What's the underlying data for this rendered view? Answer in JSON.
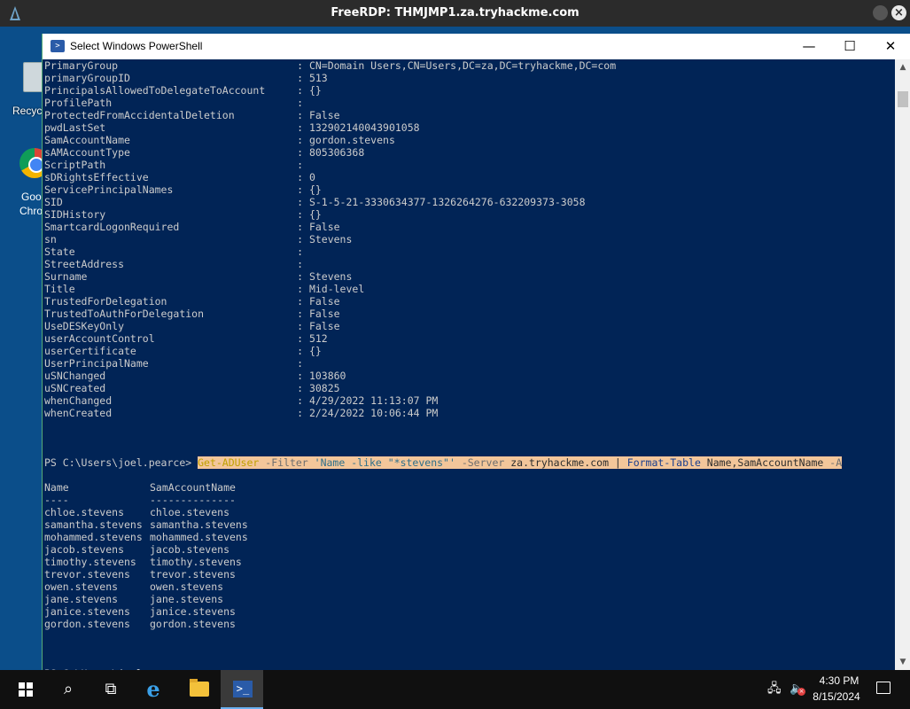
{
  "rdp": {
    "title": "FreeRDP: THMJMP1.za.tryhackme.com"
  },
  "desktop": {
    "icons": [
      {
        "label": "Recycl"
      },
      {
        "label_line1": "Goo",
        "label_line2": "Chro"
      }
    ]
  },
  "window": {
    "title": "Select Windows PowerShell",
    "minimize_glyph": "—",
    "maximize_glyph": "☐",
    "close_glyph": "✕"
  },
  "console": {
    "properties": [
      {
        "name": "PrimaryGroup",
        "value": "CN=Domain Users,CN=Users,DC=za,DC=tryhackme,DC=com"
      },
      {
        "name": "primaryGroupID",
        "value": "513"
      },
      {
        "name": "PrincipalsAllowedToDelegateToAccount",
        "value": "{}"
      },
      {
        "name": "ProfilePath",
        "value": ""
      },
      {
        "name": "ProtectedFromAccidentalDeletion",
        "value": "False"
      },
      {
        "name": "pwdLastSet",
        "value": "132902140043901058"
      },
      {
        "name": "SamAccountName",
        "value": "gordon.stevens"
      },
      {
        "name": "sAMAccountType",
        "value": "805306368"
      },
      {
        "name": "ScriptPath",
        "value": ""
      },
      {
        "name": "sDRightsEffective",
        "value": "0"
      },
      {
        "name": "ServicePrincipalNames",
        "value": "{}"
      },
      {
        "name": "SID",
        "value": "S-1-5-21-3330634377-1326264276-632209373-3058"
      },
      {
        "name": "SIDHistory",
        "value": "{}"
      },
      {
        "name": "SmartcardLogonRequired",
        "value": "False"
      },
      {
        "name": "sn",
        "value": "Stevens"
      },
      {
        "name": "State",
        "value": ""
      },
      {
        "name": "StreetAddress",
        "value": ""
      },
      {
        "name": "Surname",
        "value": "Stevens"
      },
      {
        "name": "Title",
        "value": "Mid-level"
      },
      {
        "name": "TrustedForDelegation",
        "value": "False"
      },
      {
        "name": "TrustedToAuthForDelegation",
        "value": "False"
      },
      {
        "name": "UseDESKeyOnly",
        "value": "False"
      },
      {
        "name": "userAccountControl",
        "value": "512"
      },
      {
        "name": "userCertificate",
        "value": "{}"
      },
      {
        "name": "UserPrincipalName",
        "value": ""
      },
      {
        "name": "uSNChanged",
        "value": "103860"
      },
      {
        "name": "uSNCreated",
        "value": "30825"
      },
      {
        "name": "whenChanged",
        "value": "4/29/2022 11:13:07 PM"
      },
      {
        "name": "whenCreated",
        "value": "2/24/2022 10:06:44 PM"
      }
    ],
    "prompt": "PS C:\\Users\\joel.pearce> ",
    "command": [
      {
        "text": "Get-ADUser",
        "style": "cmd-yellow"
      },
      {
        "text": " -Filter ",
        "style": "cmd-gray"
      },
      {
        "text": "'Name -like \"*stevens\"'",
        "style": "cmd-teal"
      },
      {
        "text": " -Server ",
        "style": "cmd-gray"
      },
      {
        "text": "za.tryhackme.com",
        "style": "cmd-dark"
      },
      {
        "text": " | ",
        "style": "cmd-dark"
      },
      {
        "text": "Format-Table",
        "style": "cmd-blue"
      },
      {
        "text": " Name,SamAccountName",
        "style": "cmd-dark"
      },
      {
        "text": " -A",
        "style": "cmd-gray"
      }
    ],
    "table": {
      "headers": [
        "Name",
        "SamAccountName"
      ],
      "underlines": [
        "----",
        "--------------"
      ],
      "rows": [
        [
          "chloe.stevens",
          "chloe.stevens"
        ],
        [
          "samantha.stevens",
          "samantha.stevens"
        ],
        [
          "mohammed.stevens",
          "mohammed.stevens"
        ],
        [
          "jacob.stevens",
          "jacob.stevens"
        ],
        [
          "timothy.stevens",
          "timothy.stevens"
        ],
        [
          "trevor.stevens",
          "trevor.stevens"
        ],
        [
          "owen.stevens",
          "owen.stevens"
        ],
        [
          "jane.stevens",
          "jane.stevens"
        ],
        [
          "janice.stevens",
          "janice.stevens"
        ],
        [
          "gordon.stevens",
          "gordon.stevens"
        ]
      ]
    },
    "final_prompt": "PS C:\\Users\\joel.pearce> "
  },
  "taskbar": {
    "search_glyph": "⌕",
    "taskview_glyph": "⧉",
    "ie_glyph": "e",
    "ps_glyph": ">_",
    "network_glyph": "🖧",
    "volume_glyph": "🔈",
    "volume_mute_glyph": "×",
    "time": "4:30 PM",
    "date": "8/15/2024"
  },
  "icons": [
    "freerdp-icon",
    "recycle-bin-icon",
    "chrome-icon",
    "powershell-icon",
    "start-icon",
    "search-icon",
    "task-view-icon",
    "internet-explorer-icon",
    "file-explorer-icon",
    "network-icon",
    "volume-muted-icon",
    "notification-icon"
  ],
  "colors": {
    "console_bg": "#012456",
    "console_fg": "#cccccc",
    "highlight": "#f3c69a",
    "desktop_bg": "#0b4e8a",
    "taskbar_bg": "#101010"
  }
}
